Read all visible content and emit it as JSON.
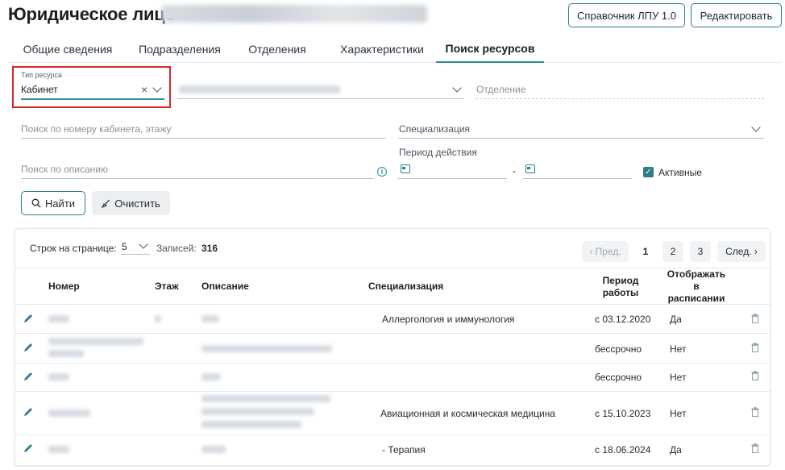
{
  "header": {
    "title": "Юридическое лицо",
    "ref_button": "Справочник ЛПУ 1.0",
    "edit_button": "Редактировать"
  },
  "tabs": [
    {
      "label": "Общие сведения"
    },
    {
      "label": "Подразделения"
    },
    {
      "label": "Отделения"
    },
    {
      "label": "Характеристики"
    },
    {
      "label": "Поиск ресурсов",
      "active": true
    }
  ],
  "filters": {
    "resource_type_label": "Тип ресурса",
    "resource_type_value": "Кабинет",
    "department_placeholder": "Отделение",
    "cabinet_search_placeholder": "Поиск по номеру кабинета, этажу",
    "specialization_placeholder": "Специализация",
    "period_label": "Период действия",
    "period_dash": "-",
    "description_placeholder": "Поиск по описанию",
    "active_label": "Активные",
    "active_checked": true,
    "info_icon": "i",
    "find_button": "Найти",
    "clear_button": "Очистить"
  },
  "pagination": {
    "rows_per_page_label": "Строк на странице:",
    "rows_per_page_value": "5",
    "records_label": "Записей:",
    "records_count": "316",
    "prev_label": "‹ Пред.",
    "next_label": "След. ›",
    "pages": [
      "1",
      "2",
      "3"
    ],
    "current_page": "1"
  },
  "table": {
    "columns": {
      "number": "Номер",
      "floor": "Этаж",
      "description": "Описание",
      "specialization": "Специализация",
      "period": "Период работы",
      "show": "Отображать в расписании"
    },
    "rows": [
      {
        "specialization": "Аллергология и иммунология",
        "period": "с 03.12.2020",
        "show": "Да"
      },
      {
        "specialization": "",
        "period": "бессрочно",
        "show": "Нет"
      },
      {
        "specialization": "",
        "period": "бессрочно",
        "show": "Нет"
      },
      {
        "specialization": "Авиационная и космическая медицина",
        "period": "с 15.10.2023",
        "show": "Нет"
      },
      {
        "specialization": "- Терапия",
        "period": "с 18.06.2024",
        "show": "Да"
      }
    ]
  },
  "colors": {
    "accent": "#2f8a98",
    "highlight_box": "#d9262b"
  }
}
